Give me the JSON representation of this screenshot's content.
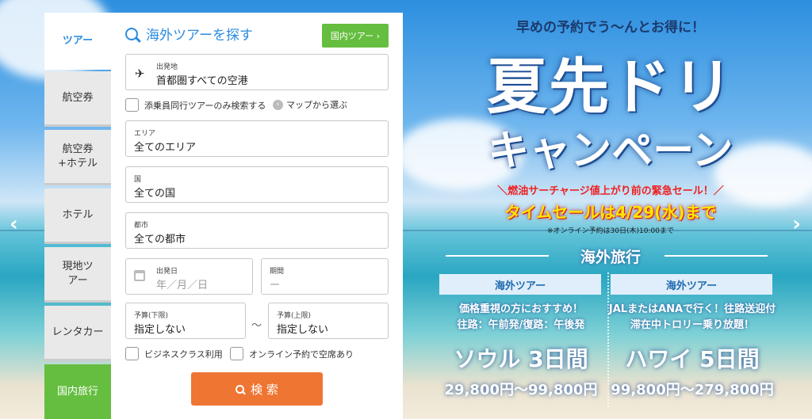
{
  "tabs": [
    {
      "label": "ツアー",
      "state": "active"
    },
    {
      "label": "航空券"
    },
    {
      "label": "航空券+ホテル"
    },
    {
      "label": "ホテル"
    },
    {
      "label": "現地ツアー"
    },
    {
      "label": "レンタカー"
    },
    {
      "label": "国内旅行"
    }
  ],
  "search_panel": {
    "title": "海外ツアーを探す",
    "domestic_button": "国内ツアー ›",
    "departure": {
      "label": "出発地",
      "value": "首都圏すべての空港"
    },
    "escort_checkbox": "添乗員同行ツアーのみ検索する",
    "map_link": "マップから選ぶ",
    "area": {
      "label": "エリア",
      "value": "全てのエリア"
    },
    "country": {
      "label": "国",
      "value": "全ての国"
    },
    "city": {
      "label": "都市",
      "value": "全ての都市"
    },
    "depart_date": {
      "label": "出発日",
      "placeholder": "年／月／日"
    },
    "period": {
      "label": "期間",
      "placeholder": "ー"
    },
    "budget_min": {
      "label": "予算(下限)",
      "value": "指定しない"
    },
    "budget_max": {
      "label": "予算(上限)",
      "value": "指定しない"
    },
    "range_sep": "〜",
    "business_checkbox": "ビジネスクラス利用",
    "online_checkbox": "オンライン予約で空席あり",
    "search_button": "検 索"
  },
  "banner": {
    "subtitle": "早めの予約でう〜んとお得に！",
    "headline_1": "夏先ドリ",
    "headline_2": "キャンペーン",
    "urgent": "＼燃油サーチャージ値上がり前の緊急セール！／",
    "sale": "タイムセールは4/29(水)まで",
    "note": "※オンライン予約は30日(木)10:00まで",
    "section": "海外旅行",
    "cards": [
      {
        "header": "海外ツアー",
        "line1": "価格重視の方におすすめ！",
        "line2": "往路：午前発/復路：午後発",
        "city": "ソウル 3日間",
        "price": "29,800円〜99,800円"
      },
      {
        "header": "海外ツアー",
        "line1": "JALまたはANAで行く！往路送迎付",
        "line2": "滞在中トロリー乗り放題！",
        "city": "ハワイ 5日間",
        "price": "99,800円〜279,800円"
      }
    ],
    "nav_left": "‹",
    "nav_right": "›"
  },
  "colors": {
    "accent": "#2a8be0",
    "green": "#65be3f",
    "search": "#ef7533"
  }
}
